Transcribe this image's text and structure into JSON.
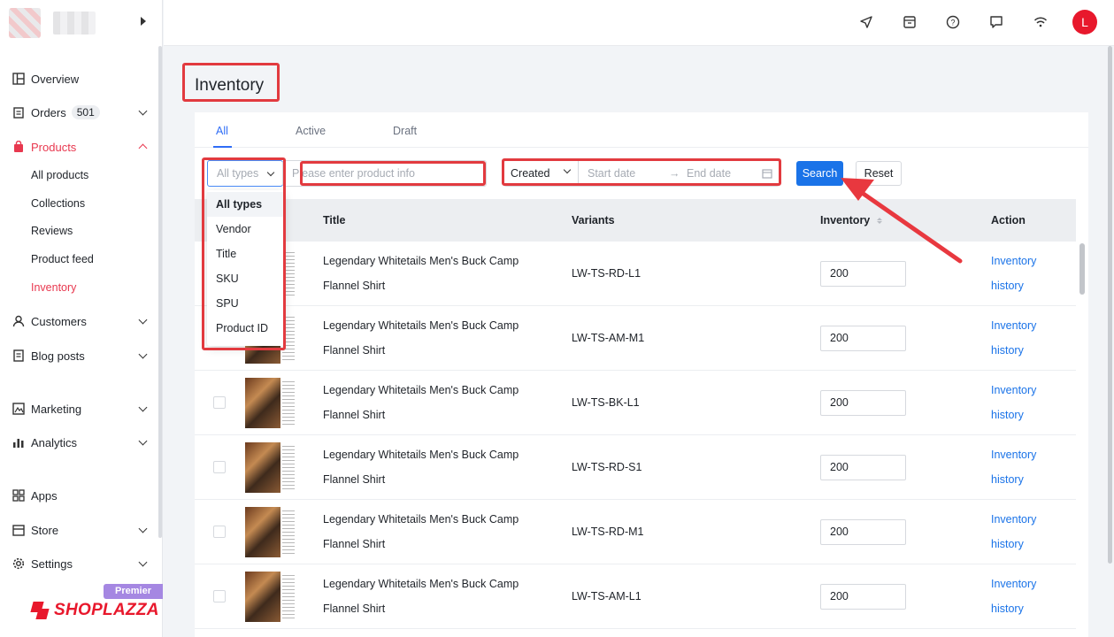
{
  "sidebar": {
    "items": [
      {
        "label": "Overview"
      },
      {
        "label": "Orders",
        "badge": "501"
      },
      {
        "label": "Products"
      },
      {
        "label": "Customers"
      },
      {
        "label": "Blog posts"
      },
      {
        "label": "Marketing"
      },
      {
        "label": "Analytics"
      },
      {
        "label": "Apps"
      },
      {
        "label": "Store"
      },
      {
        "label": "Settings"
      }
    ],
    "product_sub": [
      "All products",
      "Collections",
      "Reviews",
      "Product feed",
      "Inventory"
    ],
    "plan_badge": "Premier",
    "brand": "SHOPLAZZA"
  },
  "topbar": {
    "avatar_letter": "L"
  },
  "page": {
    "title": "Inventory"
  },
  "tabs": [
    "All",
    "Active",
    "Draft"
  ],
  "filters": {
    "type_select": "All types",
    "search_placeholder": "Please enter product info",
    "date_type": "Created",
    "start_placeholder": "Start date",
    "end_placeholder": "End date",
    "search_button": "Search",
    "reset_button": "Reset"
  },
  "dropdown": [
    "All types",
    "Vendor",
    "Title",
    "SKU",
    "SPU",
    "Product ID"
  ],
  "table": {
    "headers": [
      "Title",
      "Variants",
      "Inventory",
      "Action"
    ],
    "rows": [
      {
        "title1": "Legendary Whitetails Men's Buck Camp",
        "title2": "Flannel Shirt",
        "variant": "LW-TS-RD-L1",
        "inventory": "200",
        "action1": "Inventory",
        "action2": "history"
      },
      {
        "title1": "Legendary Whitetails Men's Buck Camp",
        "title2": "Flannel Shirt",
        "variant": "LW-TS-AM-M1",
        "inventory": "200",
        "action1": "Inventory",
        "action2": "history"
      },
      {
        "title1": "Legendary Whitetails Men's Buck Camp",
        "title2": "Flannel Shirt",
        "variant": "LW-TS-BK-L1",
        "inventory": "200",
        "action1": "Inventory",
        "action2": "history"
      },
      {
        "title1": "Legendary Whitetails Men's Buck Camp",
        "title2": "Flannel Shirt",
        "variant": "LW-TS-RD-S1",
        "inventory": "200",
        "action1": "Inventory",
        "action2": "history"
      },
      {
        "title1": "Legendary Whitetails Men's Buck Camp",
        "title2": "Flannel Shirt",
        "variant": "LW-TS-RD-M1",
        "inventory": "200",
        "action1": "Inventory",
        "action2": "history"
      },
      {
        "title1": "Legendary Whitetails Men's Buck Camp",
        "title2": "Flannel Shirt",
        "variant": "LW-TS-AM-L1",
        "inventory": "200",
        "action1": "Inventory",
        "action2": "history"
      }
    ]
  },
  "colors": {
    "accent": "#e8384f",
    "link": "#1a73e8",
    "highlight": "#e23a3f"
  }
}
